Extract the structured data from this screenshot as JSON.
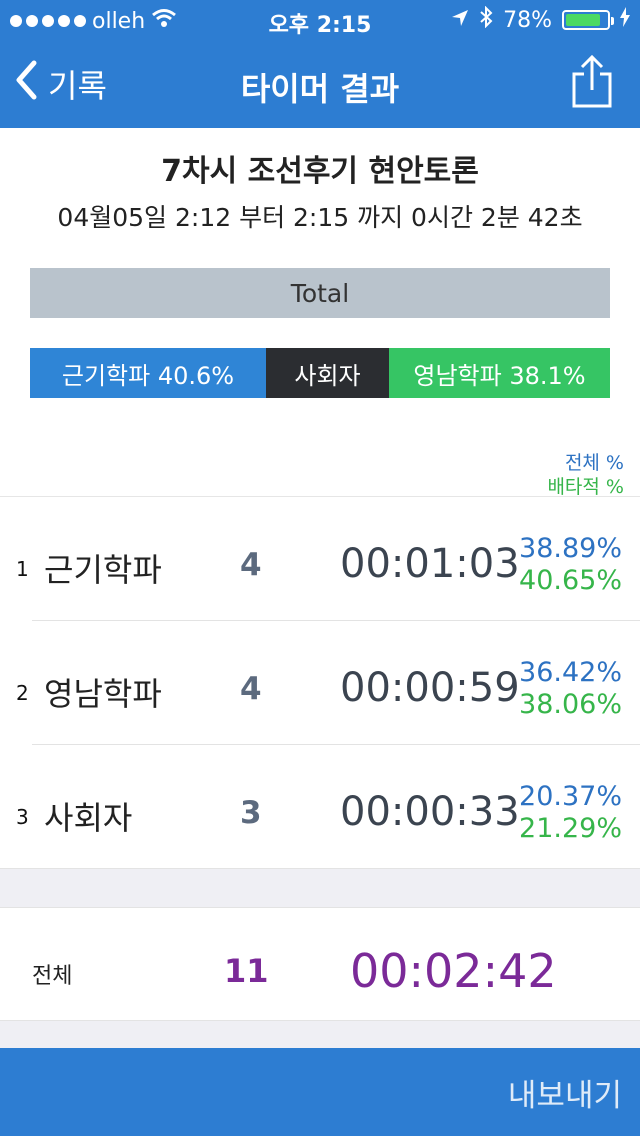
{
  "status_bar": {
    "carrier": "olleh",
    "time": "오후 2:15",
    "battery": "78%"
  },
  "nav": {
    "back_label": "기록",
    "title": "타이머 결과"
  },
  "session": {
    "title": "7차시 조선후기 현안토론",
    "range": "04월05일 2:12 부터 2:15 까지 0시간 2분 42초"
  },
  "total_bar_label": "Total",
  "segments": [
    {
      "label": "근기학파 40.6%"
    },
    {
      "label": "사회자"
    },
    {
      "label": "영남학파 38.1%"
    }
  ],
  "legend": {
    "all": "전체 %",
    "exclusive": "배타적 %"
  },
  "rows": [
    {
      "rank": "1",
      "name": "근기학파",
      "count": "4",
      "time": "00:01:03",
      "pct_all": "38.89%",
      "pct_ex": "40.65%"
    },
    {
      "rank": "2",
      "name": "영남학파",
      "count": "4",
      "time": "00:00:59",
      "pct_all": "36.42%",
      "pct_ex": "38.06%"
    },
    {
      "rank": "3",
      "name": "사회자",
      "count": "3",
      "time": "00:00:33",
      "pct_all": "20.37%",
      "pct_ex": "21.29%"
    }
  ],
  "summary": {
    "label": "전체",
    "count": "11",
    "time": "00:02:42"
  },
  "footer": {
    "export_label": "내보내기"
  },
  "colors": {
    "nav_blue": "#2d7dd2",
    "segment_blue": "#2f85d6",
    "segment_dark": "#2b2d31",
    "segment_green": "#36c564",
    "summary_purple": "#7b2a98"
  }
}
